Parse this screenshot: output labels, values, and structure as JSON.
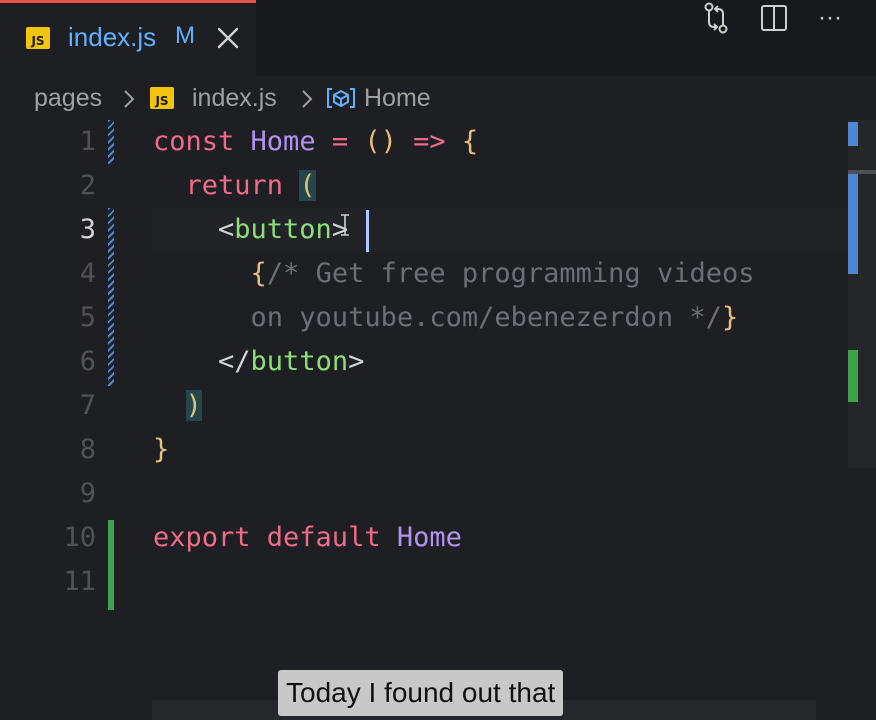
{
  "tab": {
    "filetype_badge": "JS",
    "title": "index.js",
    "modified_indicator": "M",
    "accent_color": "#e8534a"
  },
  "tab_actions": [
    {
      "icon": "git-compare-icon"
    },
    {
      "icon": "split-editor-icon"
    },
    {
      "icon": "more-actions-icon",
      "label": "···"
    }
  ],
  "breadcrumb": {
    "folder": "pages",
    "filetype_badge": "JS",
    "file": "index.js",
    "symbol_icon": "symbol-method-icon",
    "symbol": "Home"
  },
  "editor": {
    "active_line": 3,
    "lines": [
      {
        "n": "1",
        "tokens": [
          [
            "kw-red",
            "const "
          ],
          [
            "kw-purple",
            "Home"
          ],
          [
            "kw-red",
            " = "
          ],
          [
            "yel",
            "()"
          ],
          [
            "kw-red",
            " => "
          ],
          [
            "yel",
            "{"
          ]
        ]
      },
      {
        "n": "2",
        "tokens": [
          [
            "punc",
            "  "
          ],
          [
            "kw-red",
            "return "
          ],
          [
            "yel paren-hl",
            "("
          ]
        ]
      },
      {
        "n": "3",
        "tokens": [
          [
            "punc",
            "    <"
          ],
          [
            "tag",
            "button"
          ],
          [
            "punc",
            ">"
          ]
        ]
      },
      {
        "n": "4",
        "tokens": [
          [
            "punc",
            "      "
          ],
          [
            "yel",
            "{"
          ],
          [
            "cmt",
            "/* Get free programming videos"
          ]
        ]
      },
      {
        "n": "5",
        "tokens": [
          [
            "cmt",
            "      on youtube.com/ebenezerdon */"
          ],
          [
            "yel",
            "}"
          ]
        ]
      },
      {
        "n": "6",
        "tokens": [
          [
            "punc",
            "    </"
          ],
          [
            "tag",
            "button"
          ],
          [
            "punc",
            ">"
          ]
        ]
      },
      {
        "n": "7",
        "tokens": [
          [
            "punc",
            "  "
          ],
          [
            "yel paren-hl",
            ")"
          ]
        ]
      },
      {
        "n": "8",
        "tokens": [
          [
            "yel",
            "}"
          ]
        ]
      },
      {
        "n": "9",
        "tokens": []
      },
      {
        "n": "10",
        "tokens": [
          [
            "kw-red",
            "export default "
          ],
          [
            "kw-purple",
            "Home"
          ]
        ]
      },
      {
        "n": "11",
        "tokens": []
      }
    ]
  },
  "caption": "Today I found out that",
  "colors": {
    "background": "#1e1f22",
    "modified_blue": "#4f86d6",
    "added_green": "#3fa34d",
    "tab_title_blue": "#5fb1ff"
  }
}
